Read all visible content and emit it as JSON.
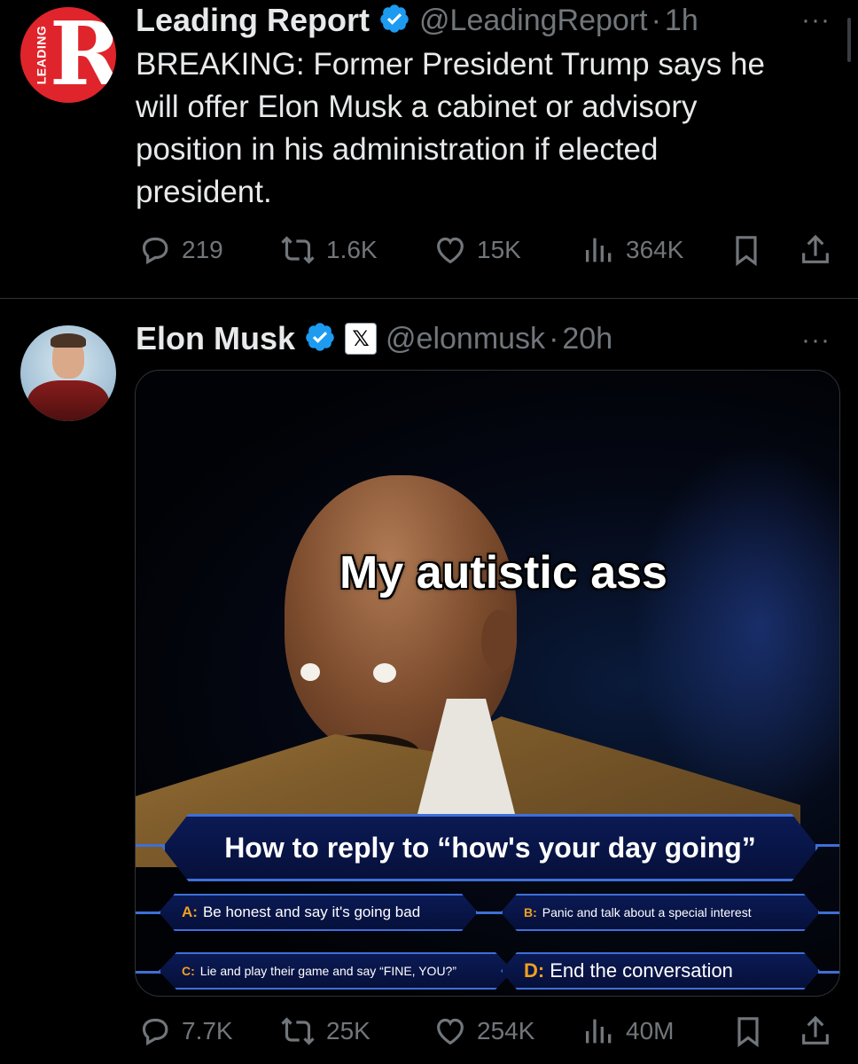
{
  "tweet1": {
    "avatar_letter": "R",
    "avatar_text": "LEADING",
    "author_name": "Leading Report",
    "handle": "@LeadingReport",
    "separator": "·",
    "time": "1h",
    "more": "···",
    "text_lines": [
      "BREAKING: Former President Trump says he",
      "will offer Elon Musk a cabinet or advisory",
      "position in his administration if elected",
      "president."
    ],
    "replies": "219",
    "reposts": "1.6K",
    "likes": "15K",
    "views": "364K"
  },
  "tweet2": {
    "author_name": "Elon Musk",
    "x_badge": "𝕏",
    "handle": "@elonmusk",
    "separator": "·",
    "time": "20h",
    "more": "···",
    "meme": {
      "caption": "My autistic ass",
      "question": "How to reply to “how's your day going”",
      "answers": [
        {
          "letter": "A:",
          "text": "Be honest and say it's going bad"
        },
        {
          "letter": "B:",
          "text": "Panic and talk about a special interest"
        },
        {
          "letter": "C:",
          "text": "Lie and play their game and say “FINE, YOU?”"
        },
        {
          "letter": "D:",
          "text": "End the conversation"
        }
      ]
    },
    "replies": "7.7K",
    "reposts": "25K",
    "likes": "254K",
    "views": "40M"
  },
  "colors": {
    "background": "#000000",
    "text": "#e7e9ea",
    "muted": "#71767b",
    "verified": "#1d9bf0",
    "brand_red": "#e0242b"
  },
  "icons": [
    "reply-icon",
    "repost-icon",
    "like-icon",
    "views-icon",
    "bookmark-icon",
    "share-icon",
    "verified-icon",
    "more-icon"
  ]
}
